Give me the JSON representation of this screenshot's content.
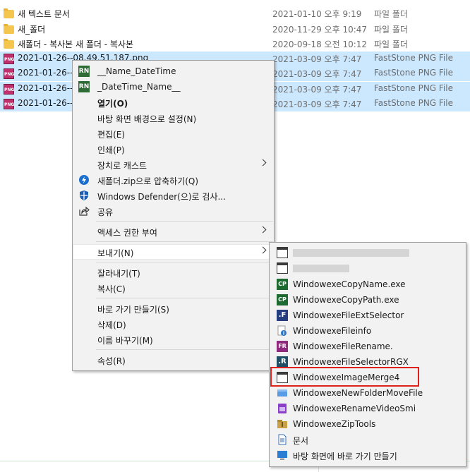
{
  "files": [
    {
      "name": "새 텍스트 문서",
      "date": "2021-01-10 오후 9:19",
      "type": "파일 폴더",
      "icon": "folder-icon",
      "selected": false
    },
    {
      "name": "새_폴더",
      "date": "2020-11-29 오후 10:47",
      "type": "파일 폴더",
      "icon": "folder-icon",
      "selected": false
    },
    {
      "name": "새폴더 - 복사본 새 폴더 - 복사본",
      "date": "2020-09-18 오전 10:12",
      "type": "파일 폴더",
      "icon": "folder-icon",
      "selected": false
    },
    {
      "name": "2021-01-26--08.49.51.187.png",
      "date": "2021-03-09 오후 7:47",
      "type": "FastStone PNG File",
      "icon": "png-icon",
      "selected": true
    },
    {
      "name": "2021-01-26--",
      "date": "2021-03-09 오후 7:47",
      "type": "FastStone PNG File",
      "icon": "png-icon",
      "selected": true
    },
    {
      "name": "2021-01-26--",
      "date": "2021-03-09 오후 7:47",
      "type": "FastStone PNG File",
      "icon": "png-icon",
      "selected": true
    },
    {
      "name": "2021-01-26--",
      "date": "2021-03-09 오후 7:47",
      "type": "FastStone PNG File",
      "icon": "png-icon",
      "selected": true
    }
  ],
  "png_badge": "PNG",
  "context_menu": {
    "items": [
      {
        "label": "__Name_DateTime",
        "icon": "rn-icon",
        "badge": "RN"
      },
      {
        "label": "_DateTime_Name__",
        "icon": "rn-icon",
        "badge": "RN"
      },
      {
        "label": "열기(O)",
        "bold": true
      },
      {
        "label": "바탕 화면 배경으로 설정(N)"
      },
      {
        "label": "편집(E)"
      },
      {
        "label": "인쇄(P)"
      },
      {
        "label": "장치로 캐스트",
        "submenu": true
      },
      {
        "label": "새폴더.zip으로 압축하기(Q)",
        "icon": "zip-icon"
      },
      {
        "label": "Windows Defender(으)로 검사...",
        "icon": "defender-icon"
      },
      {
        "label": "공유",
        "icon": "share-icon"
      },
      {
        "label": "액세스 권한 부여",
        "submenu": true
      },
      {
        "label": "보내기(N)",
        "submenu": true,
        "hover": true
      },
      {
        "label": "잘라내기(T)"
      },
      {
        "label": "복사(C)"
      },
      {
        "label": "바로 가기 만들기(S)"
      },
      {
        "label": "삭제(D)"
      },
      {
        "label": "이름 바꾸기(M)"
      },
      {
        "label": "속성(R)"
      }
    ]
  },
  "send_to_menu": {
    "items": [
      {
        "label": "",
        "icon": "window-icon",
        "blurred": true
      },
      {
        "label": "",
        "icon": "window-icon",
        "blurred": true
      },
      {
        "label": "WindowexeCopyName.exe",
        "icon": "cp-icon",
        "badge": "CP"
      },
      {
        "label": "WindowexeCopyPath.exe",
        "icon": "cp-icon",
        "badge": "CP"
      },
      {
        "label": "WindowexeFileExtSelector",
        "icon": "f-icon",
        "badge": ".F"
      },
      {
        "label": "WindowexeFileinfo",
        "icon": "fileinfo-icon"
      },
      {
        "label": "WindowexeFileRename.",
        "icon": "fr-icon",
        "badge": "FR"
      },
      {
        "label": "WindowexeFileSelectorRGX",
        "icon": "r-icon",
        "badge": ".R"
      },
      {
        "label": "WindowexeImageMerge4",
        "icon": "window-icon",
        "highlighted": true
      },
      {
        "label": "WindowexeNewFolderMoveFile",
        "icon": "newfolder-icon"
      },
      {
        "label": "WindowexeRenameVideoSmi",
        "icon": "video-icon"
      },
      {
        "label": "WindowexeZipTools",
        "icon": "zip-tools-icon"
      },
      {
        "label": "문서",
        "icon": "document-icon"
      },
      {
        "label": "바탕 화면에 바로 가기 만들기",
        "icon": "desktop-icon"
      }
    ]
  },
  "colors": {
    "selection": "#cce8ff",
    "menu_bg": "#f2f2f2",
    "highlight_border": "#e0201b"
  }
}
